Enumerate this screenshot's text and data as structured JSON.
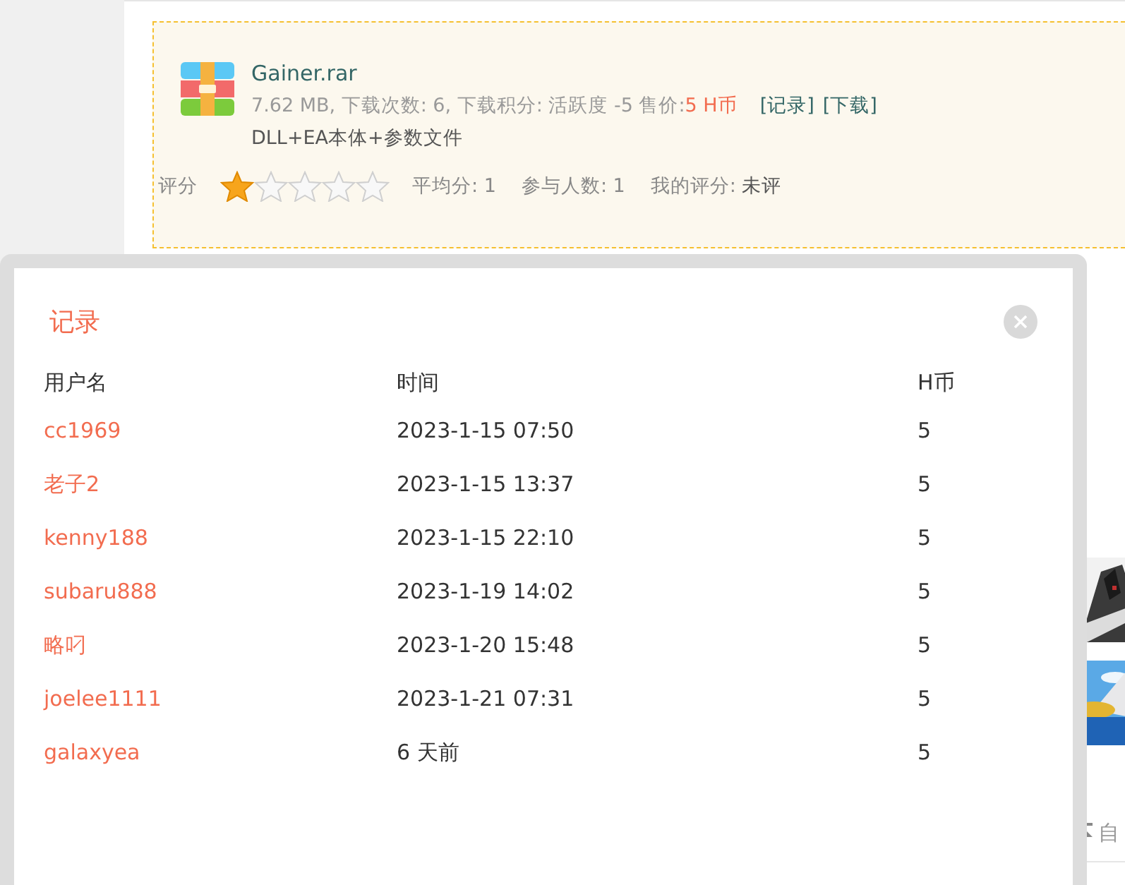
{
  "attachment": {
    "filename": "Gainer.rar",
    "meta": "7.62 MB, 下载次数: 6, 下载积分: 活跃度 -5 售价: ",
    "price": "5 H币",
    "links": [
      {
        "label": "[记录]"
      },
      {
        "label": "[下载]"
      }
    ],
    "description": "DLL+EA本体+参数文件",
    "rating_label": "评分",
    "stars": 1,
    "average": "平均分: 1",
    "participants": "参与人数: 1",
    "my_rating_label": "我的评分: ",
    "my_rating": "未评"
  },
  "side": {
    "link": "自"
  },
  "modal": {
    "title": "记录",
    "columns": [
      "用户名",
      "时间",
      "H币"
    ],
    "rows": [
      {
        "user": "cc1969",
        "time": "2023-1-15 07:50",
        "coins": "5"
      },
      {
        "user": "老子2",
        "time": "2023-1-15 13:37",
        "coins": "5"
      },
      {
        "user": "kenny188",
        "time": "2023-1-15 22:10",
        "coins": "5"
      },
      {
        "user": "subaru888",
        "time": "2023-1-19 14:02",
        "coins": "5"
      },
      {
        "user": "略叼",
        "time": "2023-1-20 15:48",
        "coins": "5"
      },
      {
        "user": "joelee1111",
        "time": "2023-1-21 07:31",
        "coins": "5"
      },
      {
        "user": "galaxyea",
        "time": "6 天前",
        "coins": "5"
      }
    ]
  }
}
